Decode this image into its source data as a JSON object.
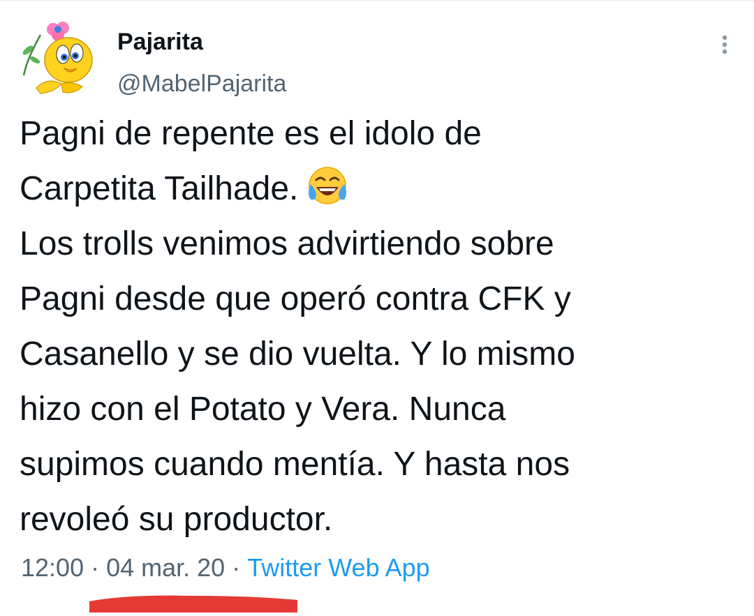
{
  "tweet": {
    "display_name": "Pajarita",
    "handle": "@MabelPajarita",
    "avatar_icon": "tweety-bird-avatar",
    "more_icon": "vertical-dots-icon",
    "text_lines": [
      "Pagni de repente es el idolo de",
      "Carpetita Tailhade.",
      "Los trolls venimos advirtiendo sobre",
      "Pagni desde que operó contra CFK y",
      "Casanello y se dio vuelta. Y lo mismo",
      "hizo con el Potato y Vera. Nunca",
      "supimos cuando mentía. Y hasta nos",
      "revoleó su productor."
    ],
    "emoji_icon": "face-with-tears-of-joy-icon",
    "time": "12:00",
    "separator": "·",
    "date": "04 mar. 20",
    "source": "Twitter Web App"
  },
  "colors": {
    "text_primary": "#0f1419",
    "text_secondary": "#536471",
    "link": "#1d9bf0",
    "annotation_red": "#e53935"
  }
}
